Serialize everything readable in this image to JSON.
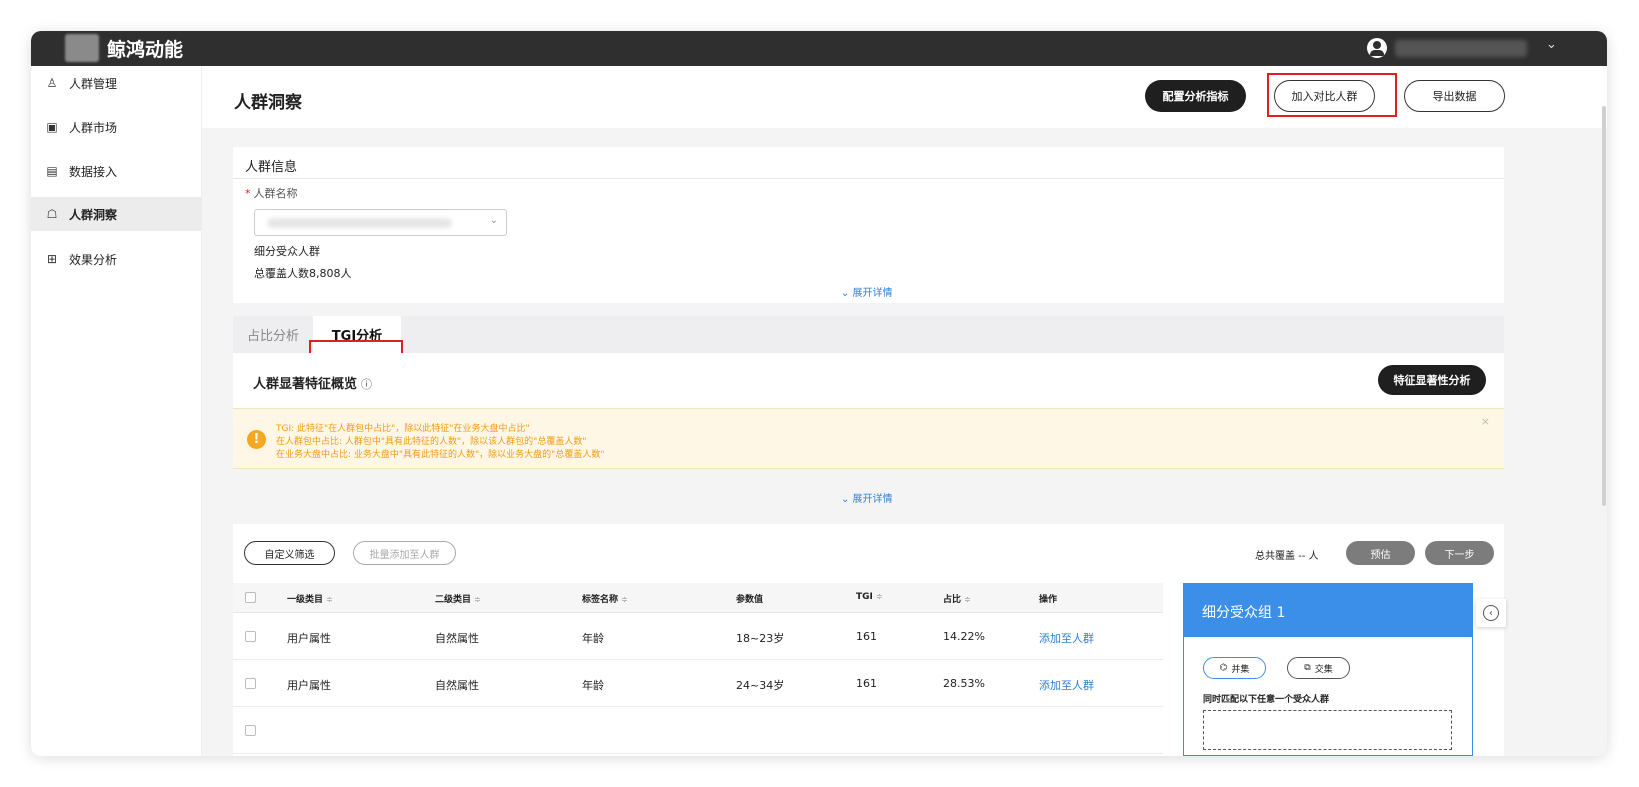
{
  "app": {
    "brand": "鲸鸿动能"
  },
  "user": {
    "caret": "⌄"
  },
  "sidebar": {
    "items": [
      {
        "icon": "♙",
        "label": "人群管理"
      },
      {
        "icon": "▣",
        "label": "人群市场"
      },
      {
        "icon": "▤",
        "label": "数据接入"
      },
      {
        "icon": "☖",
        "label": "人群洞察"
      },
      {
        "icon": "⊞",
        "label": "效果分析"
      }
    ]
  },
  "header": {
    "title": "人群洞察",
    "configure_label": "配置分析指标",
    "add_compare_label": "加入对比人群",
    "export_label": "导出数据"
  },
  "crowd_info": {
    "section_title": "人群信息",
    "name_label": "人群名称",
    "required_mark": "*",
    "select_caret": "⌄",
    "type": "细分受众人群",
    "coverage": "总覆盖人数8,808人",
    "expand": "⌄ 展开详情"
  },
  "tabs": [
    {
      "label": "占比分析"
    },
    {
      "label": "TGI分析"
    }
  ],
  "overview": {
    "title": "人群显著特征概览",
    "info_icon": "ⓘ",
    "significance_button": "特征显著性分析",
    "notice_icon": "!",
    "notice_close": "×",
    "notice_lines": [
      "TGI: 此特征\"在人群包中占比\"，除以此特征\"在业务大盘中占比\"",
      "在人群包中占比: 人群包中\"具有此特征的人数\"，除以该人群包的\"总覆盖人数\"",
      "在业务大盘中占比: 业务大盘中\"具有此特征的人数\"，除以业务大盘的\"总覆盖人数\""
    ],
    "expand": "⌄ 展开详情"
  },
  "toolbar": {
    "custom_filter": "自定义筛选",
    "batch_add": "批量添加至人群",
    "total_cover": "总共覆盖 -- 人",
    "estimate": "预估",
    "next": "下一步"
  },
  "table": {
    "sort_icon": "≑",
    "columns": [
      "一级类目",
      "二级类目",
      "标签名称",
      "参数值",
      "TGI",
      "占比",
      "操作"
    ],
    "rows": [
      {
        "cat1": "用户属性",
        "cat2": "自然属性",
        "tag": "年龄",
        "param": "18~23岁",
        "tgi": "161",
        "ratio": "14.22%",
        "action": "添加至人群"
      },
      {
        "cat1": "用户属性",
        "cat2": "自然属性",
        "tag": "年龄",
        "param": "24~34岁",
        "tgi": "161",
        "ratio": "28.53%",
        "action": "添加至人群"
      }
    ]
  },
  "segment_panel": {
    "title": "细分受众组 1",
    "union_label": "并集",
    "intersect_label": "交集",
    "union_icon": "⌬",
    "intersect_icon": "⧉",
    "hint": "同时匹配以下任意一个受众人群",
    "collapse_icon": "‹"
  }
}
